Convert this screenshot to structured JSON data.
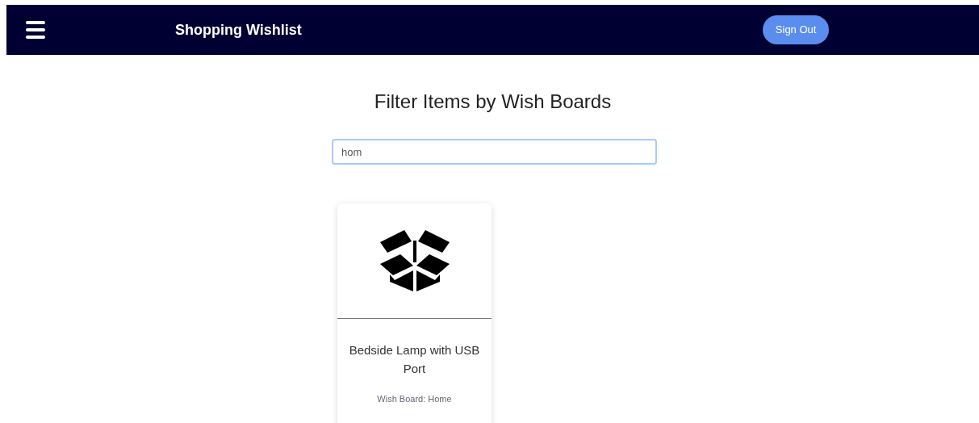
{
  "header": {
    "title": "Shopping Wishlist",
    "sign_out": "Sign Out"
  },
  "heading": "Filter Items by Wish Boards",
  "filter": {
    "value": "hom"
  },
  "items": [
    {
      "name": "Bedside Lamp with USB Port",
      "board": "Wish Board: Home"
    }
  ]
}
